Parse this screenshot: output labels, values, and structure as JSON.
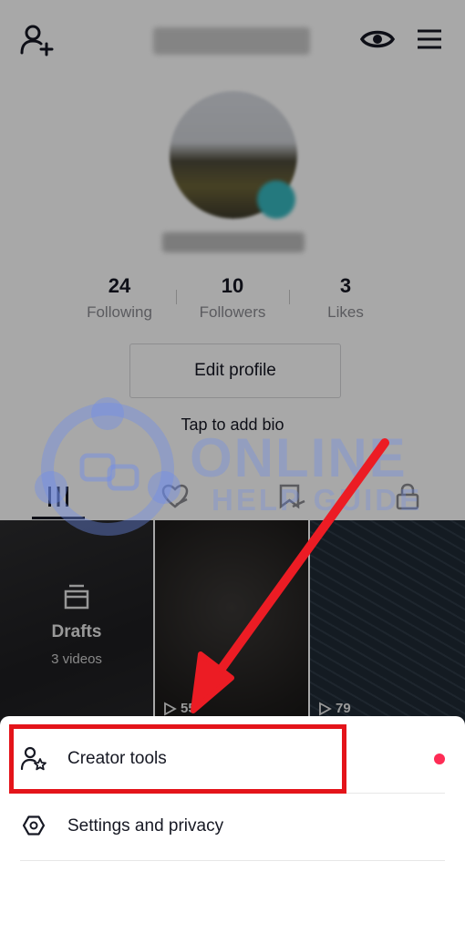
{
  "header": {
    "add_friend_icon": "person-plus-icon",
    "eye_icon": "eye-icon",
    "menu_icon": "hamburger-menu-icon"
  },
  "stats": [
    {
      "value": "24",
      "label": "Following"
    },
    {
      "value": "10",
      "label": "Followers"
    },
    {
      "value": "3",
      "label": "Likes"
    }
  ],
  "profile": {
    "edit_label": "Edit profile",
    "bio_placeholder": "Tap to add bio"
  },
  "tabs": [
    {
      "icon": "grid-icon",
      "active": true
    },
    {
      "icon": "heart-hidden-icon",
      "active": false
    },
    {
      "icon": "bookmark-hidden-icon",
      "active": false
    },
    {
      "icon": "lock-icon",
      "active": false
    }
  ],
  "videos": {
    "drafts_title": "Drafts",
    "drafts_count": "3 videos",
    "items": [
      {
        "views": "55"
      },
      {
        "views": "79"
      }
    ]
  },
  "watermark": {
    "line1": "ONLINE",
    "line2": "HELP GUIDE"
  },
  "sheet": {
    "items": [
      {
        "label": "Creator tools",
        "icon": "person-star-icon",
        "has_badge": true
      },
      {
        "label": "Settings and privacy",
        "icon": "gear-icon",
        "has_badge": false
      }
    ]
  },
  "colors": {
    "accent_red": "#fe2c55",
    "highlight": "#e4141a",
    "text": "#161823",
    "muted": "#8a8b91"
  }
}
